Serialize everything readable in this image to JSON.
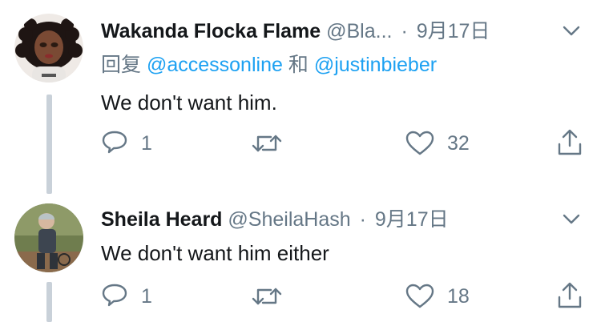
{
  "tweets": [
    {
      "name": "Wakanda Flocka Flame",
      "handle": "@Bla...",
      "separator": "·",
      "date": "9月17日",
      "reply_prefix": "回复",
      "reply_mention_1": "@accessonline",
      "reply_conj": "和",
      "reply_mention_2": "@justinbieber",
      "text": "We don't want him.",
      "reply_count": "1",
      "like_count": "32"
    },
    {
      "name": "Sheila Heard",
      "handle": "@SheilaHash",
      "separator": "·",
      "date": "9月17日",
      "text": "We don't want him either",
      "reply_count": "1",
      "like_count": "18"
    }
  ],
  "icons": [
    "chevron-down-icon",
    "reply-icon",
    "retweet-icon",
    "like-icon",
    "share-icon"
  ],
  "colors": {
    "text": "#14171a",
    "muted": "#657786",
    "link": "#1da1f2",
    "thread": "#c9d1d9"
  }
}
